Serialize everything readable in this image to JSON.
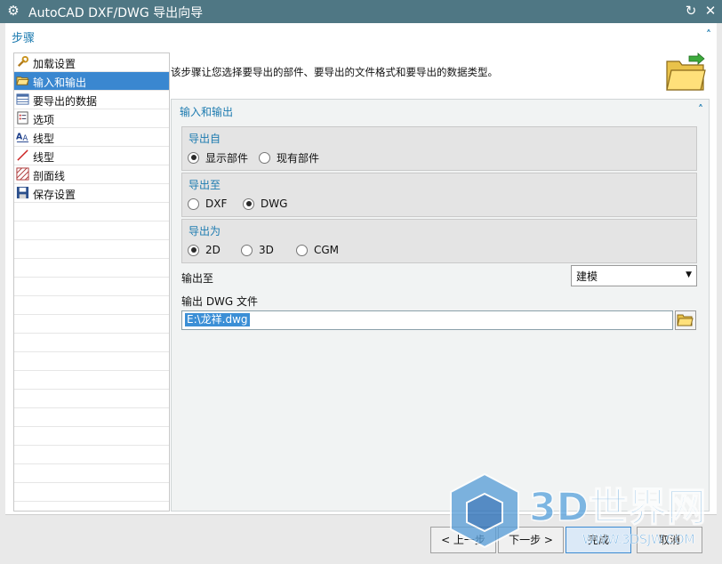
{
  "window": {
    "title": "AutoCAD DXF/DWG 导出向导",
    "icons": [
      "gear-icon",
      "reset-icon",
      "close-icon"
    ]
  },
  "steps": {
    "header": "步骤",
    "items": [
      {
        "label": "加载设置",
        "icon": "wrench-icon"
      },
      {
        "label": "输入和输出",
        "icon": "folder-open-icon",
        "selected": true
      },
      {
        "label": "要导出的数据",
        "icon": "data-table-icon"
      },
      {
        "label": "选项",
        "icon": "options-list-icon"
      },
      {
        "label": "线型",
        "icon": "text-style-icon"
      },
      {
        "label": "线型",
        "icon": "line-icon"
      },
      {
        "label": "剖面线",
        "icon": "hatch-icon"
      },
      {
        "label": "保存设置",
        "icon": "save-icon"
      }
    ]
  },
  "main": {
    "intro": "该步骤让您选择要导出的部件、要导出的文件格式和要导出的数据类型。",
    "group_title": "输入和输出",
    "export_from": {
      "caption": "导出自",
      "options": [
        "显示部件",
        "现有部件"
      ],
      "selected": "显示部件"
    },
    "export_to": {
      "caption": "导出至",
      "options": [
        "DXF",
        "DWG"
      ],
      "selected": "DWG"
    },
    "export_as": {
      "caption": "导出为",
      "options": [
        "2D",
        "3D",
        "CGM"
      ],
      "selected": "2D"
    },
    "output_to_label": "输出至",
    "output_to_value": "建模",
    "file_label": "输出 DWG 文件",
    "file_value": "E:\\龙祥.dwg"
  },
  "buttons": {
    "back": "< 上一步",
    "next": "下一步 >",
    "finish": "完成",
    "cancel": "取消"
  },
  "watermark": {
    "text": "3D世界网",
    "url": "WWW.3DSJW.COM"
  }
}
